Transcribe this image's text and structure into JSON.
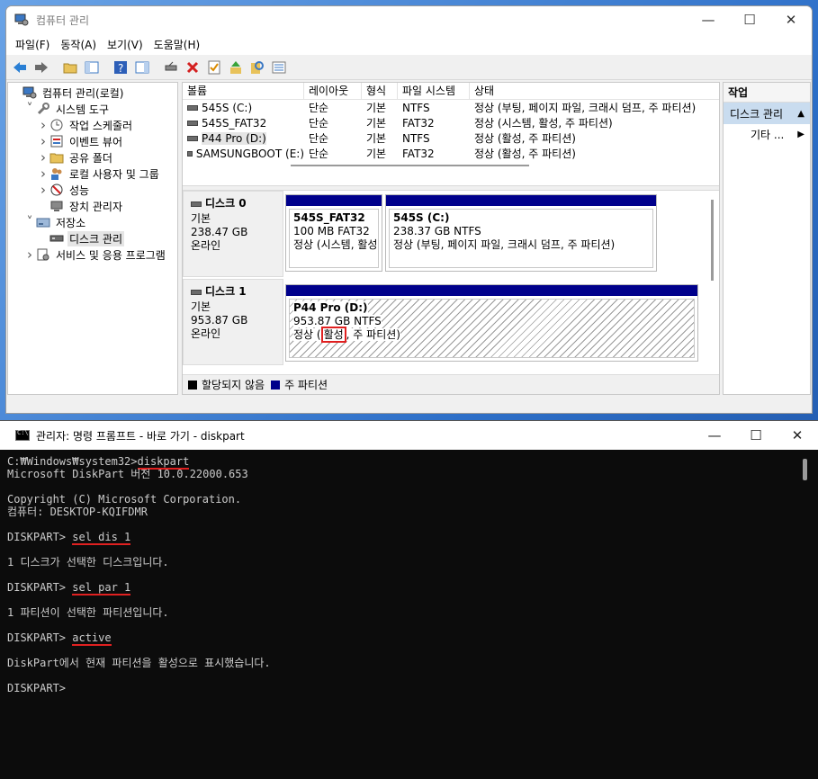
{
  "mmc": {
    "title": "컴퓨터 관리",
    "menu": [
      "파일(F)",
      "동작(A)",
      "보기(V)",
      "도움말(H)"
    ],
    "tree": [
      {
        "label": "컴퓨터 관리(로컬)",
        "exp": "",
        "indent": 0,
        "icon": "computer-icon"
      },
      {
        "label": "시스템 도구",
        "exp": "v",
        "indent": 1,
        "icon": "tools-icon"
      },
      {
        "label": "작업 스케줄러",
        "exp": ">",
        "indent": 2,
        "icon": "clock-icon"
      },
      {
        "label": "이벤트 뷰어",
        "exp": ">",
        "indent": 2,
        "icon": "event-icon"
      },
      {
        "label": "공유 폴더",
        "exp": ">",
        "indent": 2,
        "icon": "folder-icon"
      },
      {
        "label": "로컬 사용자 및 그룹",
        "exp": ">",
        "indent": 2,
        "icon": "users-icon"
      },
      {
        "label": "성능",
        "exp": ">",
        "indent": 2,
        "icon": "performance-icon"
      },
      {
        "label": "장치 관리자",
        "exp": "",
        "indent": 2,
        "icon": "device-icon"
      },
      {
        "label": "저장소",
        "exp": "v",
        "indent": 1,
        "icon": "storage-icon"
      },
      {
        "label": "디스크 관리",
        "exp": "",
        "indent": 2,
        "icon": "disk-icon"
      },
      {
        "label": "서비스 및 응용 프로그램",
        "exp": ">",
        "indent": 1,
        "icon": "services-icon"
      }
    ],
    "volume_columns": [
      "볼륨",
      "레이아웃",
      "형식",
      "파일 시스템",
      "상태"
    ],
    "volumes": [
      {
        "name": "545S (C:)",
        "layout": "단순",
        "type": "기본",
        "fs": "NTFS",
        "status": "정상 (부팅, 페이지 파일, 크래시 덤프, 주 파티션)"
      },
      {
        "name": "545S_FAT32",
        "layout": "단순",
        "type": "기본",
        "fs": "FAT32",
        "status": "정상 (시스템, 활성, 주 파티션)"
      },
      {
        "name": "P44 Pro (D:)",
        "layout": "단순",
        "type": "기본",
        "fs": "NTFS",
        "status": "정상 (활성, 주 파티션)"
      },
      {
        "name": "SAMSUNGBOOT (E:)",
        "layout": "단순",
        "type": "기본",
        "fs": "FAT32",
        "status": "정상 (활성, 주 파티션)"
      }
    ],
    "disk0": {
      "name": "디스크 0",
      "type": "기본",
      "size": "238.47 GB",
      "state": "온라인",
      "p1": {
        "name": "545S_FAT32",
        "size": "100 MB FAT32",
        "status": "정상 (시스템, 활성"
      },
      "p2": {
        "name": "545S  (C:)",
        "size": "238.37 GB NTFS",
        "status": "정상 (부팅, 페이지 파일, 크래시 덤프, 주 파티션)"
      }
    },
    "disk1": {
      "name": "디스크 1",
      "type": "기본",
      "size": "953.87 GB",
      "state": "온라인",
      "p1": {
        "name": "P44 Pro  (D:)",
        "size": "953.87 GB NTFS",
        "status_pre": "정상 (",
        "status_mark": "활성",
        "status_post": ", 주 파티션)"
      }
    },
    "legend": [
      {
        "label": "할당되지 않음",
        "color": "#000000"
      },
      {
        "label": "주 파티션",
        "color": "#00008b"
      }
    ],
    "actions": {
      "header": "작업",
      "section": "디스크 관리",
      "more": "기타 ..."
    }
  },
  "cmd": {
    "title": "관리자: 명령 프롬프트 - 바로 가기 - diskpart",
    "lines": [
      {
        "text": "C:₩Windows₩system32>",
        "cmd": "diskpart"
      },
      {
        "text": "Microsoft DiskPart 버전 10.0.22000.653",
        "cmd": ""
      },
      {
        "text": "",
        "cmd": ""
      },
      {
        "text": "Copyright (C) Microsoft Corporation.",
        "cmd": ""
      },
      {
        "text": "컴퓨터: DESKTOP-KQIFDMR",
        "cmd": ""
      },
      {
        "text": "",
        "cmd": ""
      },
      {
        "text": "DISKPART> ",
        "cmd": "sel dis 1"
      },
      {
        "text": "",
        "cmd": ""
      },
      {
        "text": "1 디스크가 선택한 디스크입니다.",
        "cmd": ""
      },
      {
        "text": "",
        "cmd": ""
      },
      {
        "text": "DISKPART> ",
        "cmd": "sel par 1"
      },
      {
        "text": "",
        "cmd": ""
      },
      {
        "text": "1 파티션이 선택한 파티션입니다.",
        "cmd": ""
      },
      {
        "text": "",
        "cmd": ""
      },
      {
        "text": "DISKPART> ",
        "cmd": "active"
      },
      {
        "text": "",
        "cmd": ""
      },
      {
        "text": "DiskPart에서 현재 파티션을 활성으로 표시했습니다.",
        "cmd": ""
      },
      {
        "text": "",
        "cmd": ""
      },
      {
        "text": "DISKPART>",
        "cmd": ""
      }
    ]
  },
  "colors": {
    "primary_partition": "#00008b",
    "highlight": "#e02020",
    "console_bg": "#0c0c0c"
  }
}
